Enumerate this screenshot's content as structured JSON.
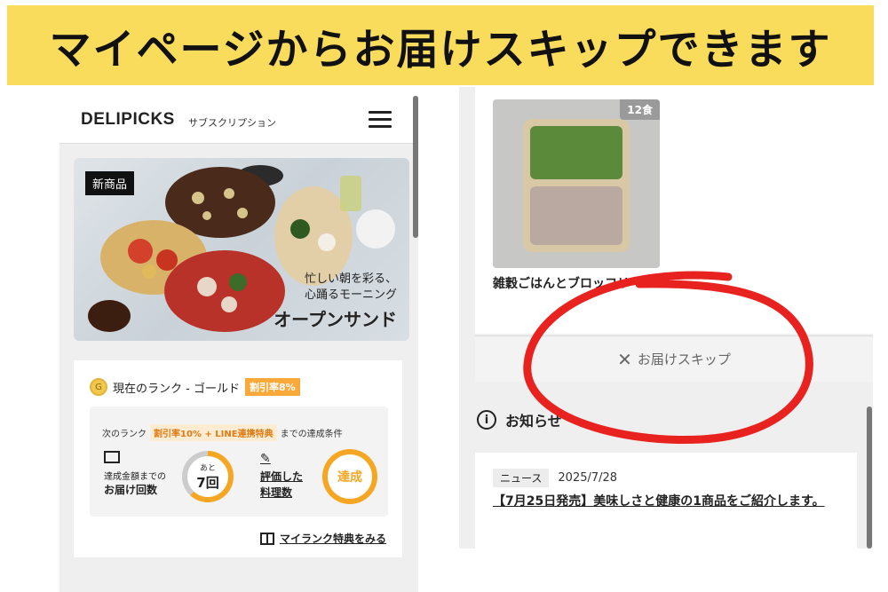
{
  "banner": {
    "title": "マイページからお届けスキップできます"
  },
  "left": {
    "logo": "DELIPICKS",
    "logo_sub": "サブスクリプション",
    "hero": {
      "badge": "新商品",
      "line1": "忙しい朝を彩る、",
      "line2": "心踊るモーニング",
      "title": "オープンサンド"
    },
    "rank": {
      "icon_letter": "G",
      "current": "現在のランク - ゴールド",
      "discount": "割引率8%",
      "next_prefix": "次のランク",
      "next_pill": "割引率10% + LINE連携特典",
      "next_suffix": "までの達成条件",
      "cond1_line1": "達成金額までの",
      "cond1_line2": "お届け回数",
      "remain_small": "あと",
      "remain_num": "7回",
      "cond2_line1": "評価した",
      "cond2_line2": "料理数",
      "achieved": "達成",
      "link": "マイランク特典をみる"
    }
  },
  "right": {
    "product": {
      "count": "12食",
      "name": "雑穀ごはんとブロッコリー"
    },
    "skip_label": "お届けスキップ",
    "info_heading": "お知らせ",
    "news": {
      "tag": "ニュース",
      "date": "2025/7/28",
      "title": "【7月25日発売】美味しさと健康の1商品をご紹介します。"
    }
  },
  "colors": {
    "banner": "#f9dc5c",
    "accent_orange": "#f5a623",
    "annotation_red": "#e8231f"
  }
}
